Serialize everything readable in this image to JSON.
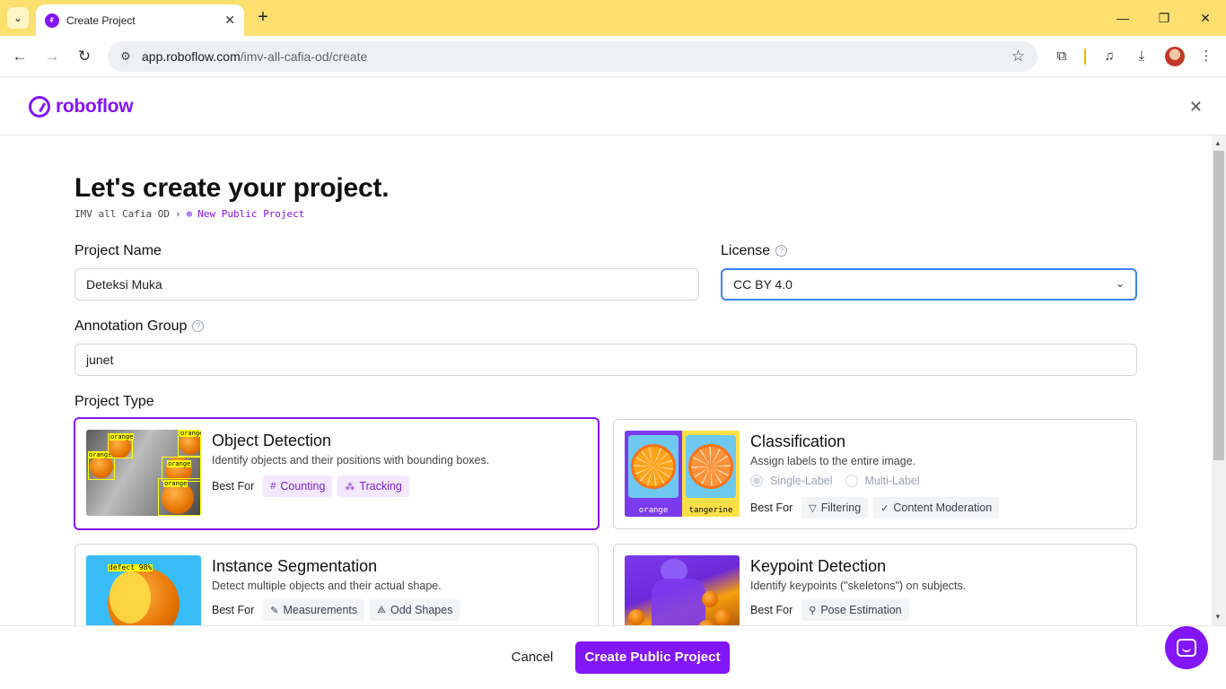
{
  "browser": {
    "tab_title": "Create Project",
    "url_host": "app.roboflow.com",
    "url_path": "/imv-all-cafia-od/create"
  },
  "app": {
    "logo_text": "roboflow",
    "heading": "Let's create your project.",
    "breadcrumb": {
      "workspace": "IMV all Cafia OD",
      "current": "New Public Project"
    }
  },
  "form": {
    "project_name_label": "Project Name",
    "project_name_value": "Deteksi Muka",
    "license_label": "License",
    "license_value": "CC BY 4.0",
    "annotation_group_label": "Annotation Group",
    "annotation_group_value": "junet",
    "project_type_label": "Project Type"
  },
  "project_types": [
    {
      "title": "Object Detection",
      "desc": "Identify objects and their positions with bounding boxes.",
      "best_for": "Best For",
      "chips": [
        "Counting",
        "Tracking"
      ],
      "selected": true
    },
    {
      "title": "Classification",
      "desc": "Assign labels to the entire image.",
      "best_for": "Best For",
      "radio": [
        "Single-Label",
        "Multi-Label"
      ],
      "chips": [
        "Filtering",
        "Content Moderation"
      ],
      "thumb_labels": [
        "orange",
        "tangerine"
      ]
    },
    {
      "title": "Instance Segmentation",
      "desc": "Detect multiple objects and their actual shape.",
      "best_for": "Best For",
      "chips": [
        "Measurements",
        "Odd Shapes"
      ],
      "thumb_label": "defect 98%"
    },
    {
      "title": "Keypoint Detection",
      "desc": "Identify keypoints (\"skeletons\") on subjects.",
      "best_for": "Best For",
      "chips": [
        "Pose Estimation"
      ]
    }
  ],
  "od_thumb_tags": [
    "orange",
    "orange",
    "orange",
    "orange",
    "orange"
  ],
  "footer": {
    "cancel": "Cancel",
    "create": "Create Public Project"
  },
  "colors": {
    "brand": "#8315f9",
    "tabbar": "#fcdf6f",
    "focus": "#3b82f6"
  }
}
